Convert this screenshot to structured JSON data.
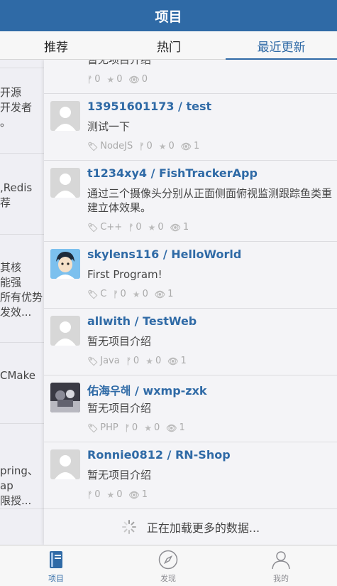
{
  "navbar": {
    "title": "项目"
  },
  "tabs": [
    {
      "label": "推荐"
    },
    {
      "label": "热门"
    },
    {
      "label": "最近更新"
    }
  ],
  "left_pane": [
    {
      "lines": [
        "",
        ""
      ]
    },
    {
      "lines": [
        "开源",
        "开发者",
        "。"
      ]
    },
    {
      "lines": [
        ",Redis",
        "荐"
      ]
    },
    {
      "lines": [
        "  其核",
        "能强",
        "所有优势",
        "发效..."
      ]
    },
    {
      "lines": [
        "CMake"
      ]
    },
    {
      "lines": [
        "pring、",
        "ap",
        "限授..."
      ]
    }
  ],
  "items": [
    {
      "title": "",
      "desc": "暂无项目介绍",
      "lang": "",
      "forks": "0",
      "stars": "0",
      "watch": "0"
    },
    {
      "title": "13951601173 / test",
      "desc": "测试一下",
      "lang": "NodeJS",
      "forks": "0",
      "stars": "0",
      "watch": "1"
    },
    {
      "title": "t1234xy4 / FishTrackerApp",
      "desc": "通过三个摄像头分别从正面侧面俯视监测跟踪鱼类重建立体效果。",
      "lang": "C++",
      "forks": "0",
      "stars": "0",
      "watch": "1"
    },
    {
      "title": "skylens116 / HelloWorld",
      "desc": "First Program!",
      "lang": "C",
      "forks": "0",
      "stars": "0",
      "watch": "1"
    },
    {
      "title": "allwith / TestWeb",
      "desc": "暂无项目介绍",
      "lang": "Java",
      "forks": "0",
      "stars": "0",
      "watch": "1"
    },
    {
      "title": "佑海우해 / wxmp-zxk",
      "desc": "暂无项目介绍",
      "lang": "PHP",
      "forks": "0",
      "stars": "0",
      "watch": "1"
    },
    {
      "title": "Ronnie0812 / RN-Shop",
      "desc": "暂无项目介绍",
      "lang": "",
      "forks": "0",
      "stars": "0",
      "watch": "1"
    }
  ],
  "loading_text": "正在加载更多的数据...",
  "tabbar": [
    {
      "label": "项目",
      "icon": "book-icon"
    },
    {
      "label": "发现",
      "icon": "compass-icon"
    },
    {
      "label": "我的",
      "icon": "person-icon"
    }
  ],
  "colors": {
    "accent": "#2f6aa6"
  }
}
